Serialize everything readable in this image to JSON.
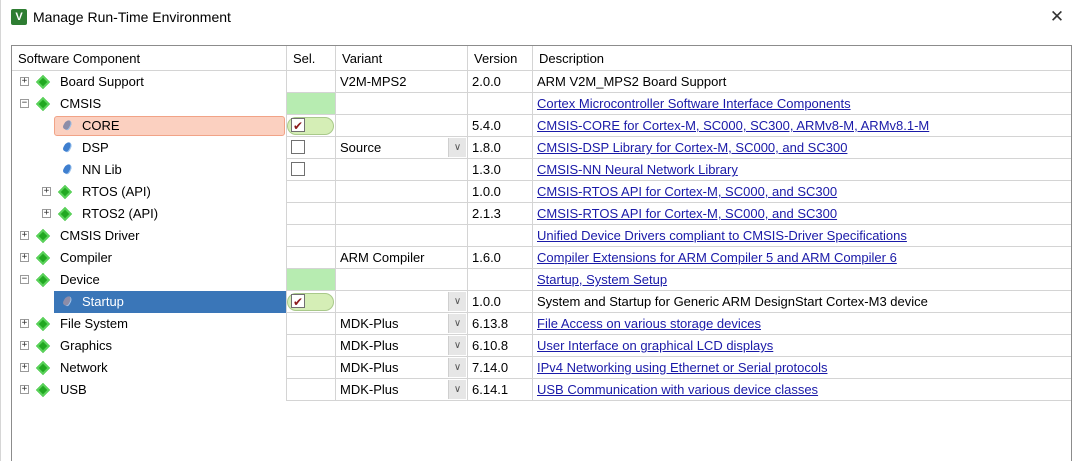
{
  "window": {
    "title": "Manage Run-Time Environment",
    "icon_name": "keil-v-icon",
    "icon_letter": "V",
    "close_glyph": "✕"
  },
  "columns": {
    "component": "Software Component",
    "sel": "Sel.",
    "variant": "Variant",
    "version": "Version",
    "description": "Description"
  },
  "rows": [
    {
      "name": "Board Support",
      "level": 0,
      "icon": "gem-icon",
      "expander": "+",
      "sel": "",
      "variant": "V2M-MPS2",
      "dropdown": false,
      "version": "2.0.0",
      "description": "ARM V2M_MPS2 Board Support",
      "link": false
    },
    {
      "name": "CMSIS",
      "level": 0,
      "icon": "gem-icon",
      "expander": "−",
      "sel": "green",
      "variant": "",
      "dropdown": false,
      "version": "",
      "description": "Cortex Microcontroller Software Interface Components",
      "link": true
    },
    {
      "name": "CORE",
      "level": 1,
      "icon": "pin-icon",
      "expander": "",
      "sel": "checked",
      "variant": "",
      "dropdown": false,
      "version": "5.4.0",
      "description": "CMSIS-CORE for Cortex-M, SC000, SC300, ARMv8-M, ARMv8.1-M",
      "link": true,
      "highlight": "core"
    },
    {
      "name": "DSP",
      "level": 1,
      "icon": "pin-icon",
      "expander": "",
      "sel": "unchecked",
      "variant": "Source",
      "dropdown": true,
      "version": "1.8.0",
      "description": "CMSIS-DSP Library for Cortex-M, SC000, and SC300",
      "link": true
    },
    {
      "name": "NN Lib",
      "level": 1,
      "icon": "pin-icon",
      "expander": "",
      "sel": "unchecked",
      "variant": "",
      "dropdown": false,
      "version": "1.3.0",
      "description": "CMSIS-NN Neural Network Library",
      "link": true
    },
    {
      "name": "RTOS (API)",
      "level": 1,
      "icon": "gem-icon",
      "expander": "+",
      "sel": "",
      "variant": "",
      "dropdown": false,
      "version": "1.0.0",
      "description": "CMSIS-RTOS API for Cortex-M, SC000, and SC300",
      "link": true
    },
    {
      "name": "RTOS2 (API)",
      "level": 1,
      "icon": "gem-icon",
      "expander": "+",
      "sel": "",
      "variant": "",
      "dropdown": false,
      "version": "2.1.3",
      "description": "CMSIS-RTOS API for Cortex-M, SC000, and SC300",
      "link": true
    },
    {
      "name": "CMSIS Driver",
      "level": 0,
      "icon": "gem-icon",
      "expander": "+",
      "sel": "",
      "variant": "",
      "dropdown": false,
      "version": "",
      "description": "Unified Device Drivers compliant to CMSIS-Driver Specifications",
      "link": true
    },
    {
      "name": "Compiler",
      "level": 0,
      "icon": "gem-icon",
      "expander": "+",
      "sel": "",
      "variant": "ARM Compiler",
      "dropdown": false,
      "version": "1.6.0",
      "description": "Compiler Extensions for ARM Compiler 5 and ARM Compiler 6",
      "link": true
    },
    {
      "name": "Device",
      "level": 0,
      "icon": "gem-icon",
      "expander": "−",
      "sel": "green",
      "variant": "",
      "dropdown": false,
      "version": "",
      "description": "Startup, System Setup",
      "link": true
    },
    {
      "name": "Startup",
      "level": 1,
      "icon": "pin-icon",
      "expander": "",
      "sel": "checked",
      "variant": "",
      "dropdown": true,
      "version": "1.0.0",
      "description": "System and Startup for Generic ARM DesignStart Cortex-M3 device",
      "link": false,
      "highlight": "selected"
    },
    {
      "name": "File System",
      "level": 0,
      "icon": "gem-icon",
      "expander": "+",
      "sel": "",
      "variant": "MDK-Plus",
      "dropdown": true,
      "version": "6.13.8",
      "description": "File Access on various storage devices",
      "link": true
    },
    {
      "name": "Graphics",
      "level": 0,
      "icon": "gem-icon",
      "expander": "+",
      "sel": "",
      "variant": "MDK-Plus",
      "dropdown": true,
      "version": "6.10.8",
      "description": "User Interface on graphical LCD displays",
      "link": true
    },
    {
      "name": "Network",
      "level": 0,
      "icon": "gem-icon",
      "expander": "+",
      "sel": "",
      "variant": "MDK-Plus",
      "dropdown": true,
      "version": "7.14.0",
      "description": "IPv4 Networking using Ethernet or Serial protocols",
      "link": true
    },
    {
      "name": "USB",
      "level": 0,
      "icon": "gem-icon",
      "expander": "+",
      "sel": "",
      "variant": "MDK-Plus",
      "dropdown": true,
      "version": "6.14.1",
      "description": "USB Communication with various device classes",
      "link": true
    }
  ],
  "colors": {
    "link": "#1a1aa8",
    "selected_row": "#3a76b8",
    "core_highlight": "#fbd0c0",
    "sel_green": "#b7ecb1"
  }
}
